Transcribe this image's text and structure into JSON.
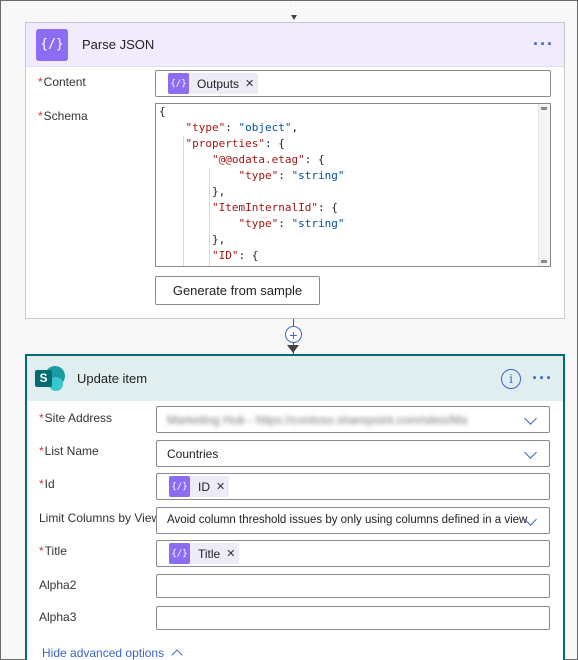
{
  "parse_json": {
    "title": "Parse JSON",
    "icon_glyph": "{/}",
    "more_label": "···",
    "content_label": "Content",
    "content_token": "Outputs",
    "schema_label": "Schema",
    "schema_lines": [
      "{",
      "    \"type\": \"object\",",
      "    \"properties\": {",
      "        \"@@odata.etag\": {",
      "            \"type\": \"string\"",
      "        },",
      "        \"ItemInternalId\": {",
      "            \"type\": \"string\"",
      "        },",
      "        \"ID\": {"
    ],
    "generate_button": "Generate from sample"
  },
  "connector": {
    "plus": "+"
  },
  "update_item": {
    "title": "Update item",
    "info_glyph": "i",
    "more_label": "···",
    "site_address_label": "Site Address",
    "site_address_value": "Marketing Hub - https://contoso.sharepoint.com/sites/Marketing",
    "list_name_label": "List Name",
    "list_name_value": "Countries",
    "id_label": "Id",
    "id_token": "ID",
    "limit_columns_label": "Limit Columns by View",
    "limit_columns_value": "Avoid column threshold issues by only using columns defined in a view",
    "title_label": "Title",
    "title_token": "Title",
    "alpha2_label": "Alpha2",
    "alpha3_label": "Alpha3",
    "hide_advanced": "Hide advanced options"
  },
  "colors": {
    "accent_purple": "#8c6cf2",
    "sharepoint_teal": "#036c70",
    "link_blue": "#3a67c8",
    "required_red": "#d13438"
  }
}
